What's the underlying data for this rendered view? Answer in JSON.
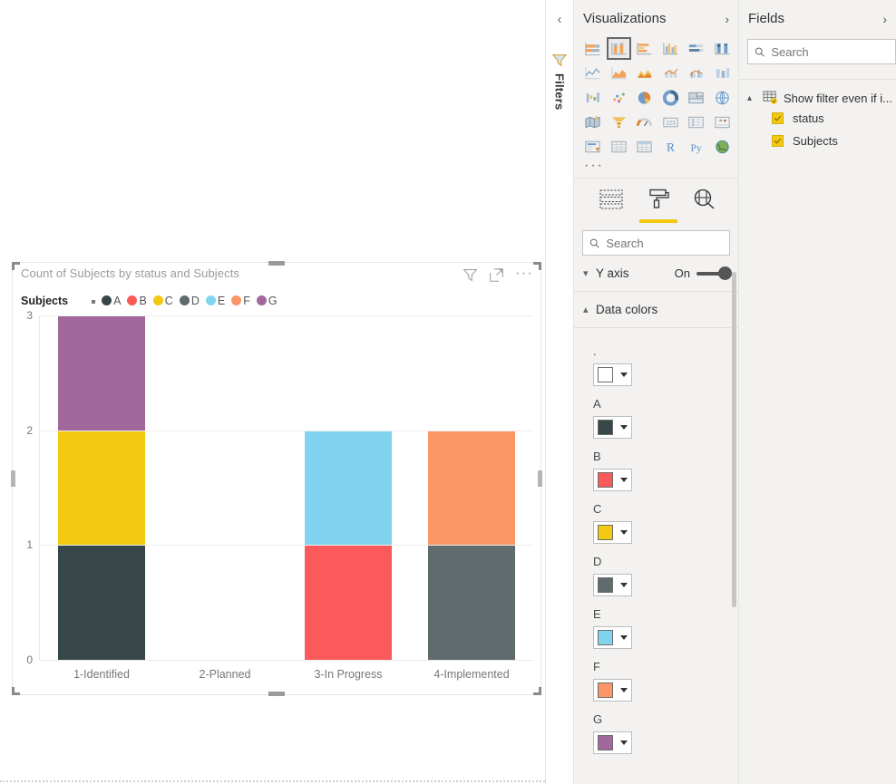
{
  "canvas": {
    "visual": {
      "title": "Count of Subjects by status and Subjects",
      "header_icons": [
        {
          "name": "filter-icon",
          "label": "Filters"
        },
        {
          "name": "focus-mode-icon",
          "label": "Focus mode"
        },
        {
          "name": "more-options-icon",
          "label": "More options"
        }
      ],
      "legend_title": "Subjects"
    }
  },
  "chart_data": {
    "type": "bar",
    "title": "Count of Subjects by status and Subjects",
    "stacked": true,
    "xlabel": "",
    "ylabel": "",
    "ylim": [
      0,
      3
    ],
    "yticks": [
      "0",
      "1",
      "2",
      "3"
    ],
    "grid": true,
    "legend_position": "top",
    "legend_title": "Subjects",
    "categories": [
      "1-Identified",
      "2-Planned",
      "3-In Progress",
      "4-Implemented"
    ],
    "series": [
      {
        "name": ".",
        "color": "#FFFFFF",
        "values": [
          0,
          0,
          0,
          0
        ]
      },
      {
        "name": "A",
        "color": "#374649",
        "values": [
          1,
          0,
          0,
          0
        ]
      },
      {
        "name": "B",
        "color": "#FB5A5A",
        "values": [
          0,
          0,
          1,
          0
        ]
      },
      {
        "name": "C",
        "color": "#F2C811",
        "values": [
          1,
          0,
          0,
          0
        ]
      },
      {
        "name": "D",
        "color": "#5F6B6D",
        "values": [
          0,
          0,
          0,
          1
        ]
      },
      {
        "name": "E",
        "color": "#81D4EF",
        "values": [
          0,
          0,
          1,
          0
        ]
      },
      {
        "name": "F",
        "color": "#FC9666",
        "values": [
          0,
          0,
          0,
          1
        ]
      },
      {
        "name": "G",
        "color": "#A2689C",
        "values": [
          1,
          0,
          0,
          0
        ]
      }
    ],
    "totals": [
      3,
      0,
      2,
      2
    ]
  },
  "filters_rail": {
    "collapse_label": "‹",
    "title": "Filters"
  },
  "visualizations": {
    "title": "Visualizations",
    "expand_label": "›",
    "more_label": "···",
    "icons": [
      {
        "name": "stacked-bar-chart-icon",
        "selected": false
      },
      {
        "name": "stacked-column-chart-icon",
        "selected": true
      },
      {
        "name": "clustered-bar-chart-icon",
        "selected": false
      },
      {
        "name": "clustered-column-chart-icon",
        "selected": false
      },
      {
        "name": "hundred-percent-stacked-bar-chart-icon",
        "selected": false
      },
      {
        "name": "hundred-percent-stacked-column-chart-icon",
        "selected": false
      },
      {
        "name": "line-chart-icon",
        "selected": false
      },
      {
        "name": "area-chart-icon",
        "selected": false
      },
      {
        "name": "stacked-area-chart-icon",
        "selected": false
      },
      {
        "name": "line-and-stacked-column-chart-icon",
        "selected": false
      },
      {
        "name": "line-and-clustered-column-chart-icon",
        "selected": false
      },
      {
        "name": "ribbon-chart-icon",
        "selected": false
      },
      {
        "name": "waterfall-chart-icon",
        "selected": false
      },
      {
        "name": "scatter-chart-icon",
        "selected": false
      },
      {
        "name": "pie-chart-icon",
        "selected": false
      },
      {
        "name": "donut-chart-icon",
        "selected": false
      },
      {
        "name": "treemap-icon",
        "selected": false
      },
      {
        "name": "map-icon",
        "selected": false
      },
      {
        "name": "filled-map-icon",
        "selected": false
      },
      {
        "name": "funnel-chart-icon",
        "selected": false
      },
      {
        "name": "gauge-icon",
        "selected": false
      },
      {
        "name": "card-icon",
        "selected": false
      },
      {
        "name": "multi-row-card-icon",
        "selected": false
      },
      {
        "name": "kpi-icon",
        "selected": false
      },
      {
        "name": "slicer-icon",
        "selected": false
      },
      {
        "name": "table-icon",
        "selected": false
      },
      {
        "name": "matrix-icon",
        "selected": false
      },
      {
        "name": "r-script-visual-icon",
        "selected": false
      },
      {
        "name": "python-visual-icon",
        "selected": false
      },
      {
        "name": "arcgis-map-icon",
        "selected": false
      }
    ],
    "tabs": [
      {
        "name": "fields-tab",
        "label": "Fields",
        "selected": false
      },
      {
        "name": "format-tab",
        "label": "Format",
        "selected": true
      },
      {
        "name": "analytics-tab",
        "label": "Analytics",
        "selected": false
      }
    ],
    "search": {
      "placeholder": "Search",
      "value": ""
    },
    "sections": [
      {
        "label": "Y axis",
        "expanded": false,
        "toggle": "On"
      },
      {
        "label": "Data colors",
        "expanded": true
      }
    ],
    "data_colors": [
      {
        "label": ".",
        "color": "#FFFFFF"
      },
      {
        "label": "A",
        "color": "#374649"
      },
      {
        "label": "B",
        "color": "#FB5A5A"
      },
      {
        "label": "C",
        "color": "#F2C811"
      },
      {
        "label": "D",
        "color": "#5F6B6D"
      },
      {
        "label": "E",
        "color": "#81D4EF"
      },
      {
        "label": "F",
        "color": "#FC9666"
      },
      {
        "label": "G",
        "color": "#A2689C"
      }
    ]
  },
  "fields": {
    "title": "Fields",
    "expand_label": "›",
    "search": {
      "placeholder": "Search",
      "value": ""
    },
    "tables": [
      {
        "name": "Show filter even if i...",
        "expanded": true,
        "fields": [
          {
            "name": "status",
            "checked": true
          },
          {
            "name": "Subjects",
            "checked": true
          }
        ]
      }
    ]
  }
}
